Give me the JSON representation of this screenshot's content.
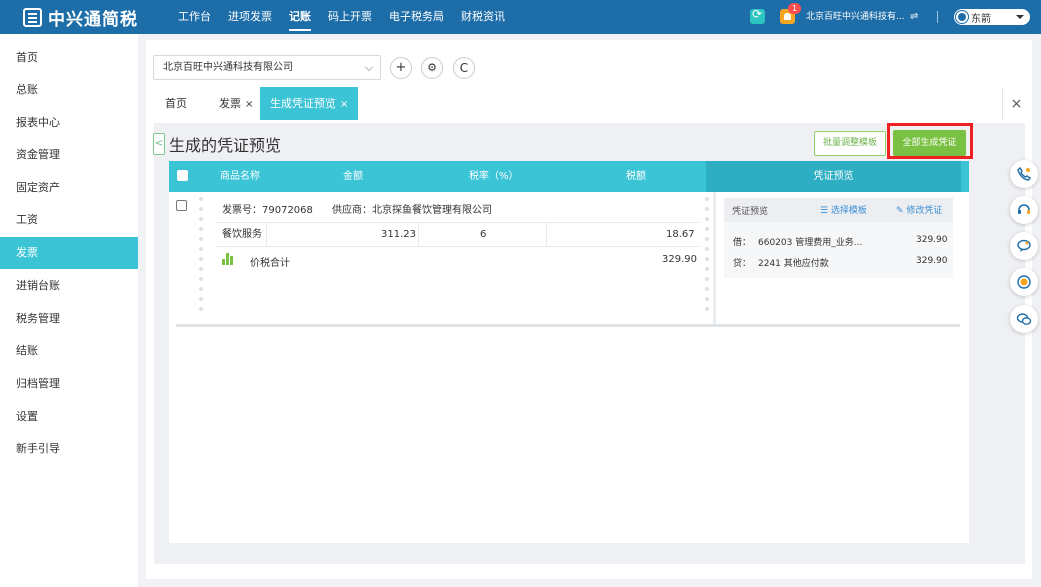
{
  "app": {
    "logo_text": "中兴通简税",
    "nav": [
      "工作台",
      "进项发票",
      "记账",
      "码上开票",
      "电子税务局",
      "财税资讯"
    ],
    "nav_active_index": 2,
    "notification_count": "1",
    "company_short": "北京百旺中兴通科技有...",
    "switch_icon": "⇌",
    "user_name": "东箭"
  },
  "sidebar": {
    "items": [
      "首页",
      "总账",
      "报表中心",
      "资金管理",
      "固定资产",
      "工资",
      "发票",
      "进销台账",
      "税务管理",
      "结账",
      "归档管理",
      "设置",
      "新手引导"
    ],
    "active_index": 6
  },
  "toolbar": {
    "company_selected": "北京百旺中兴通科技有限公司",
    "add_label": "+",
    "settings_label": "⚙",
    "refresh_label": "C"
  },
  "tabs": {
    "home": "首页",
    "invoice": "发票",
    "preview": "生成凭证预览",
    "close_mark": "×"
  },
  "page": {
    "back_label": "<",
    "title": "生成的凭证预览",
    "batch_btn": "批量调整模板",
    "gen_all_btn": "全部生成凭证"
  },
  "table": {
    "headers": {
      "name": "商品名称",
      "amount": "金额",
      "tax_rate": "税率（%）",
      "tax": "税额",
      "voucher_preview": "凭证预览"
    },
    "invoice": {
      "number_text": "发票号：79072068",
      "supplier_text": "供应商：北京探鱼餐饮管理有限公司",
      "item": {
        "name": "餐饮服务",
        "amount": "311.23",
        "tax_rate": "6",
        "tax": "18.67"
      },
      "total_label": "价税合计",
      "total_amount": "329.90"
    }
  },
  "voucher": {
    "title": "凭证预览",
    "select_template": "☰ 选择模板",
    "edit_voucher": "✎ 修改凭证",
    "entries": [
      {
        "dc": "借：",
        "account": "660203 管理费用_业务...",
        "amount": "329.90"
      },
      {
        "dc": "贷：",
        "account": "2241 其他应付款",
        "amount": "329.90"
      }
    ]
  },
  "colors": {
    "topbar": "#1d6ea8",
    "accent": "#3bc3d6",
    "green": "#7ac143",
    "highlight": "#f02020"
  }
}
